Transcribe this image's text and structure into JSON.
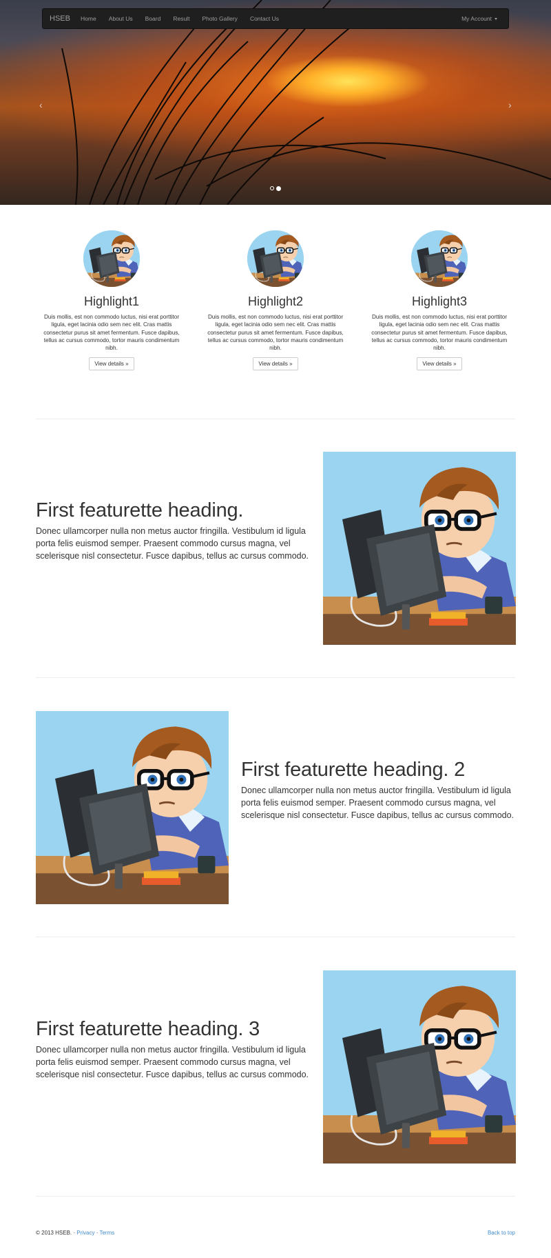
{
  "navbar": {
    "brand": "HSEB",
    "items": [
      {
        "label": "Home"
      },
      {
        "label": "About Us"
      },
      {
        "label": "Board"
      },
      {
        "label": "Result"
      },
      {
        "label": "Photo Gallery"
      },
      {
        "label": "Contact Us"
      }
    ],
    "account": "My Account"
  },
  "carousel": {
    "prev": "‹",
    "next": "›",
    "active_slide": 2,
    "slide_count": 2
  },
  "highlights": [
    {
      "title": "Highlight1",
      "text": "Duis mollis, est non commodo luctus, nisi erat porttitor ligula, eget lacinia odio sem nec elit. Cras mattis consectetur purus sit amet fermentum. Fusce dapibus, tellus ac cursus commodo, tortor mauris condimentum nibh.",
      "button": "View details »"
    },
    {
      "title": "Highlight2",
      "text": "Duis mollis, est non commodo luctus, nisi erat porttitor ligula, eget lacinia odio sem nec elit. Cras mattis consectetur purus sit amet fermentum. Fusce dapibus, tellus ac cursus commodo, tortor mauris condimentum nibh.",
      "button": "View details »"
    },
    {
      "title": "Highlight3",
      "text": "Duis mollis, est non commodo luctus, nisi erat porttitor ligula, eget lacinia odio sem nec elit. Cras mattis consectetur purus sit amet fermentum. Fusce dapibus, tellus ac cursus commodo, tortor mauris condimentum nibh.",
      "button": "View details »"
    }
  ],
  "featurettes": [
    {
      "heading": "First featurette heading.",
      "text": "Donec ullamcorper nulla non metus auctor fringilla. Vestibulum id ligula porta felis euismod semper. Praesent commodo cursus magna, vel scelerisque nisl consectetur. Fusce dapibus, tellus ac cursus commodo."
    },
    {
      "heading": "First featurette heading. 2",
      "text": "Donec ullamcorper nulla non metus auctor fringilla. Vestibulum id ligula porta felis euismod semper. Praesent commodo cursus magna, vel scelerisque nisl consectetur. Fusce dapibus, tellus ac cursus commodo."
    },
    {
      "heading": "First featurette heading. 3",
      "text": "Donec ullamcorper nulla non metus auctor fringilla. Vestibulum id ligula porta felis euismod semper. Praesent commodo cursus magna, vel scelerisque nisl consectetur. Fusce dapibus, tellus ac cursus commodo."
    }
  ],
  "footer": {
    "copyright": "© 2013 HSEB. ·",
    "privacy": "Privacy",
    "sep": "·",
    "terms": "Terms",
    "back_to_top": "Back to top"
  },
  "colors": {
    "navbar_bg": "#1f1f1f",
    "link": "#428bca"
  }
}
